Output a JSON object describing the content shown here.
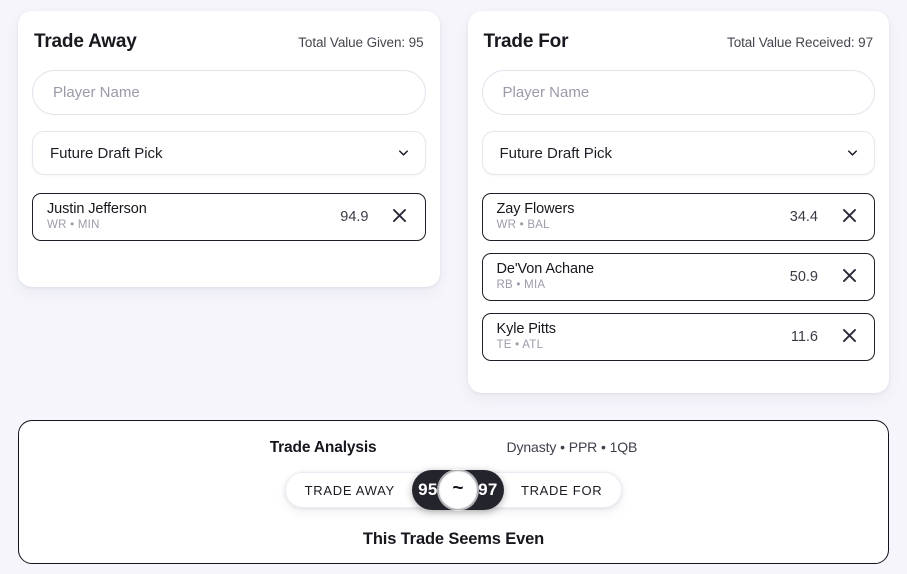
{
  "trade_away": {
    "title": "Trade Away",
    "total_label": "Total Value Given: 95",
    "search_placeholder": "Player Name",
    "search_value": "",
    "pick_select_value": "Future Draft Pick",
    "players": [
      {
        "name": "Justin Jefferson",
        "meta": "WR • MIN",
        "value": "94.9"
      }
    ]
  },
  "trade_for": {
    "title": "Trade For",
    "total_label": "Total Value Received: 97",
    "search_placeholder": "Player Name",
    "search_value": "",
    "pick_select_value": "Future Draft Pick",
    "players": [
      {
        "name": "Zay Flowers",
        "meta": "WR • BAL",
        "value": "34.4"
      },
      {
        "name": "De'Von Achane",
        "meta": "RB • MIA",
        "value": "50.9"
      },
      {
        "name": "Kyle Pitts",
        "meta": "TE • ATL",
        "value": "11.6"
      }
    ]
  },
  "analysis": {
    "title": "Trade Analysis",
    "format": "Dynasty • PPR • 1QB",
    "left_label": "TRADE AWAY",
    "right_label": "TRADE FOR",
    "left_score": "95",
    "right_score": "97",
    "balance_glyph": "~",
    "verdict": "This Trade Seems Even"
  },
  "icons": {
    "remove": "close-x-icon",
    "dropdown": "chevron-down-icon"
  },
  "colors": {
    "page_background": "#f5f5fb",
    "card_background": "#ffffff",
    "text_primary": "#16161d",
    "text_muted": "#9c9caa",
    "badge_dark": "#24242c",
    "border_strong": "#13131c"
  }
}
